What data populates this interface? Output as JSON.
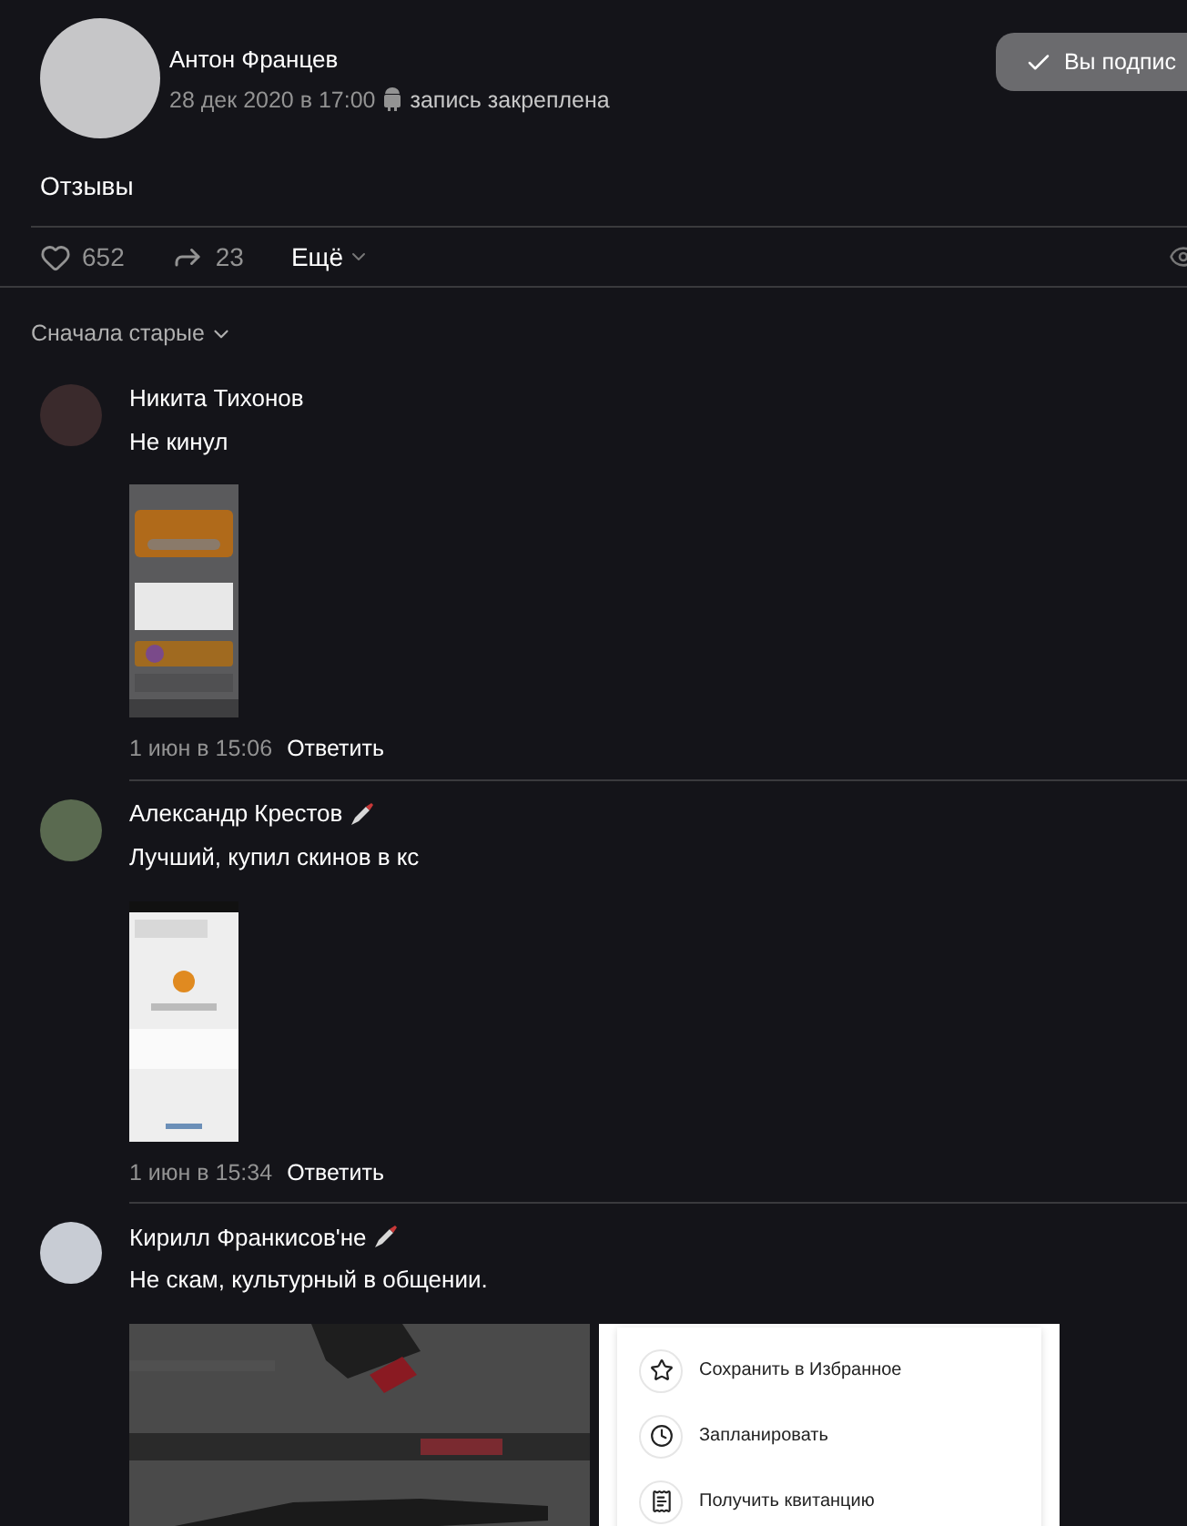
{
  "post": {
    "author": "Антон Францев",
    "date": "28 дек 2020 в 17:00",
    "pinned_note": "запись закреплена",
    "subscribe_button": "Вы подпис",
    "text": "Отзывы",
    "likes": "652",
    "shares": "23",
    "more": "Ещё"
  },
  "sort": "Сначала старые",
  "comments": [
    {
      "author": "Никита Тихонов",
      "badge": false,
      "text": "Не кинул",
      "attachments": [
        {
          "kind": "phone"
        }
      ],
      "date": "1 июн в 15:06",
      "reply": "Ответить"
    },
    {
      "author": "Александр Крестов",
      "badge": true,
      "text": "Лучший, купил скинов в кс",
      "attachments": [
        {
          "kind": "phone"
        }
      ],
      "date": "1 июн в 15:34",
      "reply": "Ответить"
    },
    {
      "author": "Кирилл Франкисов'не",
      "badge": true,
      "text": "Не скам, культурный в общении.",
      "attachments": [
        {
          "kind": "picture"
        },
        {
          "kind": "menu",
          "items": [
            "Сохранить в Избранное",
            "Запланировать",
            "Получить квитанцию"
          ]
        }
      ]
    }
  ]
}
